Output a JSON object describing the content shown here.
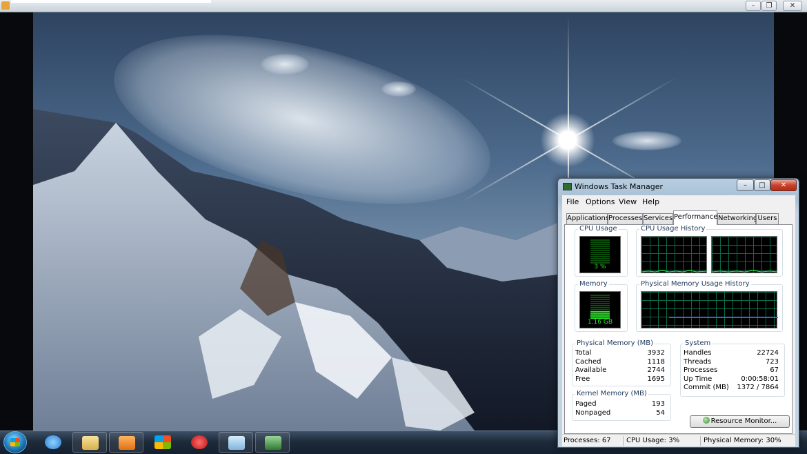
{
  "task_manager": {
    "title": "Windows Task Manager",
    "menu": [
      "File",
      "Options",
      "View",
      "Help"
    ],
    "tabs": [
      "Applications",
      "Processes",
      "Services",
      "Performance",
      "Networking",
      "Users"
    ],
    "active_tab": "Performance",
    "cpu_usage": {
      "label": "CPU Usage",
      "value": "3 %",
      "level": 0.03
    },
    "cpu_history": {
      "label": "CPU Usage History"
    },
    "memory": {
      "label": "Memory",
      "value": "1.16 GB",
      "level": 0.3
    },
    "memory_history": {
      "label": "Physical Memory Usage History"
    },
    "physical_memory": {
      "label": "Physical Memory (MB)",
      "rows": [
        {
          "name": "Total",
          "value": "3932"
        },
        {
          "name": "Cached",
          "value": "1118"
        },
        {
          "name": "Available",
          "value": "2744"
        },
        {
          "name": "Free",
          "value": "1695"
        }
      ]
    },
    "kernel_memory": {
      "label": "Kernel Memory (MB)",
      "rows": [
        {
          "name": "Paged",
          "value": "193"
        },
        {
          "name": "Nonpaged",
          "value": "54"
        }
      ]
    },
    "system": {
      "label": "System",
      "rows": [
        {
          "name": "Handles",
          "value": "22724"
        },
        {
          "name": "Threads",
          "value": "723"
        },
        {
          "name": "Processes",
          "value": "67"
        },
        {
          "name": "Up Time",
          "value": "0:00:58:01"
        },
        {
          "name": "Commit (MB)",
          "value": "1372 / 7864"
        }
      ]
    },
    "resource_monitor_label": "Resource Monitor...",
    "status": {
      "processes": "Processes: 67",
      "cpu": "CPU Usage: 3%",
      "memory": "Physical Memory: 30%"
    }
  },
  "taskbar": {
    "items": [
      {
        "name": "internet-explorer",
        "color": "#2a7fd4"
      },
      {
        "name": "windows-explorer",
        "color": "#e8c860"
      },
      {
        "name": "media-player",
        "color": "#f08a24"
      },
      {
        "name": "windows-media-center",
        "color": "#5aa04a"
      },
      {
        "name": "red-app",
        "color": "#d42a2a"
      },
      {
        "name": "remote-desktop",
        "color": "#8ac0e8"
      },
      {
        "name": "task-manager",
        "color": "#3a8a3a"
      }
    ]
  },
  "colors": {
    "meter_on": "#27e727",
    "graph_grid": "#0a6a4a",
    "memory_line": "#2d6bd8"
  }
}
